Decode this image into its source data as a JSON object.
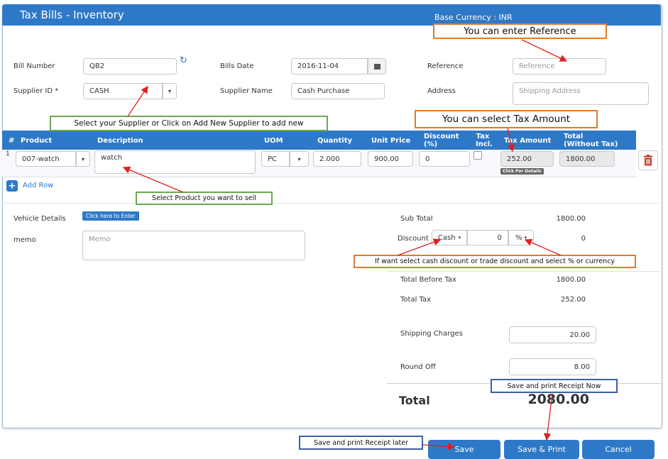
{
  "header": {
    "title": "Tax Bills - Inventory",
    "base_currency": "Base Currency : INR"
  },
  "form": {
    "bill_number_label": "Bill Number",
    "bill_number_value": "QB2",
    "bills_date_label": "Bills Date",
    "bills_date_value": "2016-11-04",
    "reference_label": "Reference",
    "reference_placeholder": "Reference",
    "supplier_id_label": "Supplier ID *",
    "supplier_id_value": "CASH",
    "supplier_name_label": "Supplier Name",
    "supplier_name_value": "Cash Purchase",
    "address_label": "Address",
    "address_placeholder": "Shipping Address"
  },
  "table": {
    "headers": {
      "num": "#",
      "product": "Product",
      "description": "Description",
      "uom": "UOM",
      "quantity": "Quantity",
      "unit_price": "Unit Price",
      "discount_l1": "Discount",
      "discount_l2": "(%)",
      "tax_incl_l1": "Tax",
      "tax_incl_l2": "Incl.",
      "tax_amount": "Tax Amount",
      "total_l1": "Total",
      "total_l2": "(Without Tax)"
    },
    "rows": [
      {
        "num": "1",
        "product": "007-watch",
        "description": "watch",
        "uom": "PC",
        "quantity": "2.000",
        "unit_price": "900.00",
        "discount": "0",
        "tax_amount": "252.00",
        "tax_hint": "Click For Details",
        "total": "1800.00"
      }
    ],
    "add_row": "Add Row"
  },
  "extras": {
    "vehicle_label": "Vehicle Details",
    "vehicle_button": "Click here to Enter",
    "memo_label": "memo",
    "memo_placeholder": "Memo"
  },
  "summary": {
    "sub_total_label": "Sub Total",
    "sub_total_value": "1800.00",
    "discount_label": "Discount",
    "discount_type": "Cash",
    "discount_input": "0",
    "discount_unit": "%",
    "discount_value": "0",
    "total_before_tax_label": "Total Before Tax",
    "total_before_tax_value": "1800.00",
    "total_tax_label": "Total Tax",
    "total_tax_value": "252.00",
    "shipping_label": "Shipping Charges",
    "shipping_value": "20.00",
    "round_off_label": "Round Off",
    "round_off_value": "8.00",
    "total_label": "Total",
    "total_value": "2080.00"
  },
  "buttons": {
    "save": "Save",
    "save_print": "Save & Print",
    "cancel": "Cancel"
  },
  "annotations": {
    "reference": "You can enter Reference",
    "supplier": "Select your Supplier or Click  on Add  New  Supplier to add new",
    "tax_amount": "You can select Tax Amount",
    "product": "Select Product you want to sell",
    "discount": "If want select cash discount or trade discount and select % or currency",
    "print_now": "Save and print Receipt Now",
    "print_later": "Save and print Receipt later"
  },
  "colors": {
    "primary": "#2e79c7",
    "callout_orange": "#e07b2e",
    "callout_green": "#6aa84f",
    "callout_blue": "#3c5fa8",
    "arrow": "#e02020",
    "delete": "#c0392b"
  },
  "icons": {
    "refresh": "refresh-icon",
    "calendar": "calendar-icon",
    "add": "plus-icon",
    "delete": "trash-icon",
    "dropdown": "caret-down-icon"
  }
}
